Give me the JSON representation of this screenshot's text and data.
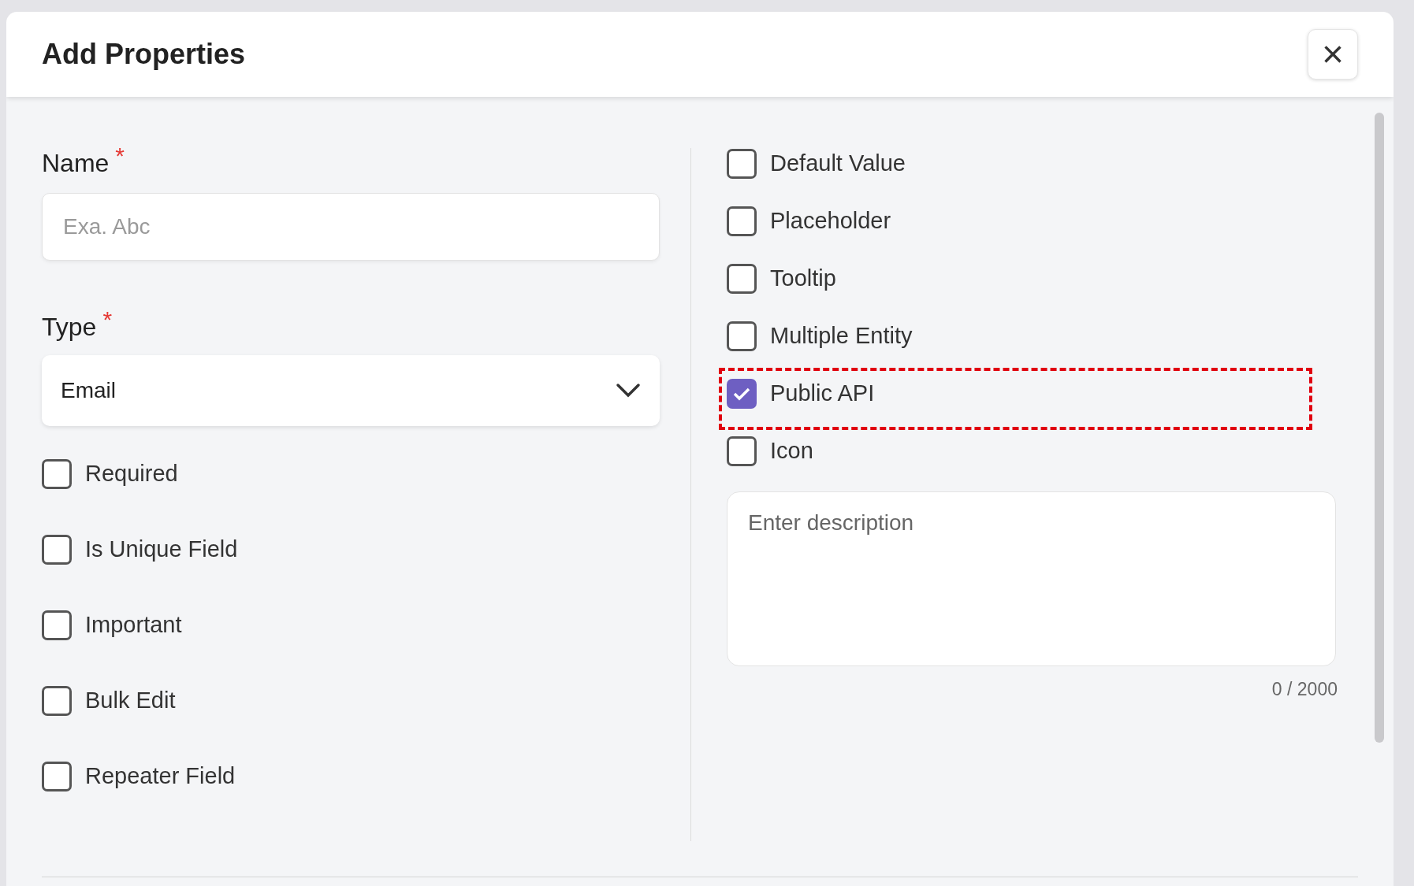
{
  "dialog": {
    "title": "Add Properties",
    "close": "×"
  },
  "name_field": {
    "label": "Name",
    "required": true,
    "required_mark": "*",
    "placeholder": "Exa. Abc"
  },
  "type_field": {
    "label": "Type",
    "required": true,
    "required_mark": "*",
    "value": "Email"
  },
  "left_options": [
    {
      "label": "Required",
      "checked": false
    },
    {
      "label": "Is Unique Field",
      "checked": false
    },
    {
      "label": "Important",
      "checked": false
    },
    {
      "label": "Bulk Edit",
      "checked": false
    },
    {
      "label": "Repeater Field",
      "checked": false
    }
  ],
  "right_options": [
    {
      "label": "Default Value",
      "checked": false,
      "highlighted": false
    },
    {
      "label": "Placeholder",
      "checked": false,
      "highlighted": false
    },
    {
      "label": "Tooltip",
      "checked": false,
      "highlighted": false
    },
    {
      "label": "Multiple Entity",
      "checked": false,
      "highlighted": false
    },
    {
      "label": "Public API",
      "checked": true,
      "highlighted": true
    },
    {
      "label": "Icon",
      "checked": false,
      "highlighted": false
    }
  ],
  "description": {
    "placeholder": "Enter description",
    "counter": "0 / 2000"
  }
}
